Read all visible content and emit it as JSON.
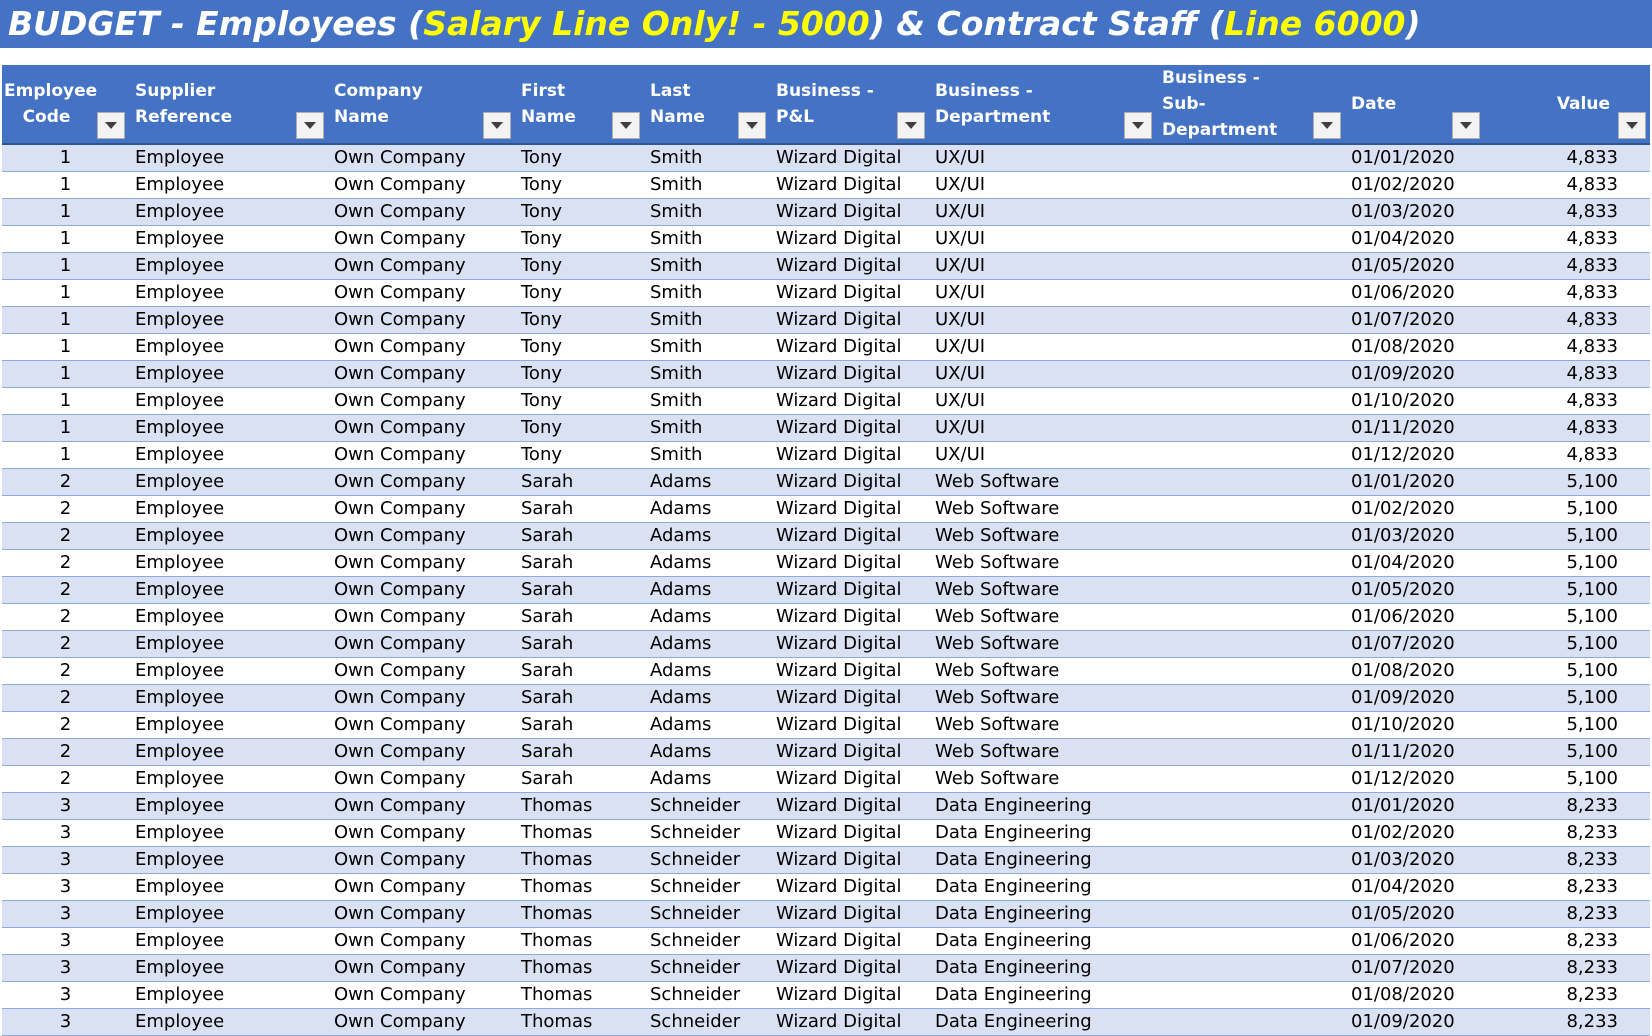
{
  "title": {
    "part1": "BUDGET - Employees (",
    "highlight1": "Salary Line Only! - 5000",
    "part2": ") & Contract Staff (",
    "highlight2": "Line 6000",
    "part3": ")"
  },
  "columns": [
    "Employee Code",
    "Supplier Reference",
    "Company Name",
    "First Name",
    "Last Name",
    "Business - P&L",
    "Business - Department",
    "Business - Sub-Department",
    "Date",
    "Value"
  ],
  "rows": [
    [
      "1",
      "Employee",
      "Own Company",
      "Tony",
      "Smith",
      "Wizard Digital",
      "UX/UI",
      "",
      "01/01/2020",
      "4,833"
    ],
    [
      "1",
      "Employee",
      "Own Company",
      "Tony",
      "Smith",
      "Wizard Digital",
      "UX/UI",
      "",
      "01/02/2020",
      "4,833"
    ],
    [
      "1",
      "Employee",
      "Own Company",
      "Tony",
      "Smith",
      "Wizard Digital",
      "UX/UI",
      "",
      "01/03/2020",
      "4,833"
    ],
    [
      "1",
      "Employee",
      "Own Company",
      "Tony",
      "Smith",
      "Wizard Digital",
      "UX/UI",
      "",
      "01/04/2020",
      "4,833"
    ],
    [
      "1",
      "Employee",
      "Own Company",
      "Tony",
      "Smith",
      "Wizard Digital",
      "UX/UI",
      "",
      "01/05/2020",
      "4,833"
    ],
    [
      "1",
      "Employee",
      "Own Company",
      "Tony",
      "Smith",
      "Wizard Digital",
      "UX/UI",
      "",
      "01/06/2020",
      "4,833"
    ],
    [
      "1",
      "Employee",
      "Own Company",
      "Tony",
      "Smith",
      "Wizard Digital",
      "UX/UI",
      "",
      "01/07/2020",
      "4,833"
    ],
    [
      "1",
      "Employee",
      "Own Company",
      "Tony",
      "Smith",
      "Wizard Digital",
      "UX/UI",
      "",
      "01/08/2020",
      "4,833"
    ],
    [
      "1",
      "Employee",
      "Own Company",
      "Tony",
      "Smith",
      "Wizard Digital",
      "UX/UI",
      "",
      "01/09/2020",
      "4,833"
    ],
    [
      "1",
      "Employee",
      "Own Company",
      "Tony",
      "Smith",
      "Wizard Digital",
      "UX/UI",
      "",
      "01/10/2020",
      "4,833"
    ],
    [
      "1",
      "Employee",
      "Own Company",
      "Tony",
      "Smith",
      "Wizard Digital",
      "UX/UI",
      "",
      "01/11/2020",
      "4,833"
    ],
    [
      "1",
      "Employee",
      "Own Company",
      "Tony",
      "Smith",
      "Wizard Digital",
      "UX/UI",
      "",
      "01/12/2020",
      "4,833"
    ],
    [
      "2",
      "Employee",
      "Own Company",
      "Sarah",
      "Adams",
      "Wizard Digital",
      "Web Software",
      "",
      "01/01/2020",
      "5,100"
    ],
    [
      "2",
      "Employee",
      "Own Company",
      "Sarah",
      "Adams",
      "Wizard Digital",
      "Web Software",
      "",
      "01/02/2020",
      "5,100"
    ],
    [
      "2",
      "Employee",
      "Own Company",
      "Sarah",
      "Adams",
      "Wizard Digital",
      "Web Software",
      "",
      "01/03/2020",
      "5,100"
    ],
    [
      "2",
      "Employee",
      "Own Company",
      "Sarah",
      "Adams",
      "Wizard Digital",
      "Web Software",
      "",
      "01/04/2020",
      "5,100"
    ],
    [
      "2",
      "Employee",
      "Own Company",
      "Sarah",
      "Adams",
      "Wizard Digital",
      "Web Software",
      "",
      "01/05/2020",
      "5,100"
    ],
    [
      "2",
      "Employee",
      "Own Company",
      "Sarah",
      "Adams",
      "Wizard Digital",
      "Web Software",
      "",
      "01/06/2020",
      "5,100"
    ],
    [
      "2",
      "Employee",
      "Own Company",
      "Sarah",
      "Adams",
      "Wizard Digital",
      "Web Software",
      "",
      "01/07/2020",
      "5,100"
    ],
    [
      "2",
      "Employee",
      "Own Company",
      "Sarah",
      "Adams",
      "Wizard Digital",
      "Web Software",
      "",
      "01/08/2020",
      "5,100"
    ],
    [
      "2",
      "Employee",
      "Own Company",
      "Sarah",
      "Adams",
      "Wizard Digital",
      "Web Software",
      "",
      "01/09/2020",
      "5,100"
    ],
    [
      "2",
      "Employee",
      "Own Company",
      "Sarah",
      "Adams",
      "Wizard Digital",
      "Web Software",
      "",
      "01/10/2020",
      "5,100"
    ],
    [
      "2",
      "Employee",
      "Own Company",
      "Sarah",
      "Adams",
      "Wizard Digital",
      "Web Software",
      "",
      "01/11/2020",
      "5,100"
    ],
    [
      "2",
      "Employee",
      "Own Company",
      "Sarah",
      "Adams",
      "Wizard Digital",
      "Web Software",
      "",
      "01/12/2020",
      "5,100"
    ],
    [
      "3",
      "Employee",
      "Own Company",
      "Thomas",
      "Schneider",
      "Wizard Digital",
      "Data Engineering",
      "",
      "01/01/2020",
      "8,233"
    ],
    [
      "3",
      "Employee",
      "Own Company",
      "Thomas",
      "Schneider",
      "Wizard Digital",
      "Data Engineering",
      "",
      "01/02/2020",
      "8,233"
    ],
    [
      "3",
      "Employee",
      "Own Company",
      "Thomas",
      "Schneider",
      "Wizard Digital",
      "Data Engineering",
      "",
      "01/03/2020",
      "8,233"
    ],
    [
      "3",
      "Employee",
      "Own Company",
      "Thomas",
      "Schneider",
      "Wizard Digital",
      "Data Engineering",
      "",
      "01/04/2020",
      "8,233"
    ],
    [
      "3",
      "Employee",
      "Own Company",
      "Thomas",
      "Schneider",
      "Wizard Digital",
      "Data Engineering",
      "",
      "01/05/2020",
      "8,233"
    ],
    [
      "3",
      "Employee",
      "Own Company",
      "Thomas",
      "Schneider",
      "Wizard Digital",
      "Data Engineering",
      "",
      "01/06/2020",
      "8,233"
    ],
    [
      "3",
      "Employee",
      "Own Company",
      "Thomas",
      "Schneider",
      "Wizard Digital",
      "Data Engineering",
      "",
      "01/07/2020",
      "8,233"
    ],
    [
      "3",
      "Employee",
      "Own Company",
      "Thomas",
      "Schneider",
      "Wizard Digital",
      "Data Engineering",
      "",
      "01/08/2020",
      "8,233"
    ],
    [
      "3",
      "Employee",
      "Own Company",
      "Thomas",
      "Schneider",
      "Wizard Digital",
      "Data Engineering",
      "",
      "01/09/2020",
      "8,233"
    ]
  ],
  "colors": {
    "header_bg": "#4472C4",
    "title_highlight": "#FFFF00",
    "band_row": "#D9E1F2",
    "row_border": "#8EA9DB"
  },
  "icons": {
    "filter_button": "chevron-down-icon"
  }
}
